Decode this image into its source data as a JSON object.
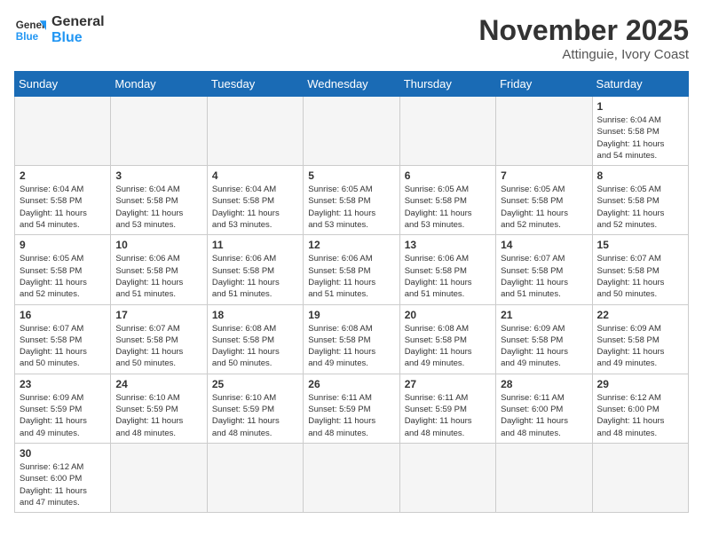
{
  "header": {
    "logo_general": "General",
    "logo_blue": "Blue",
    "month_title": "November 2025",
    "location": "Attinguie, Ivory Coast"
  },
  "weekdays": [
    "Sunday",
    "Monday",
    "Tuesday",
    "Wednesday",
    "Thursday",
    "Friday",
    "Saturday"
  ],
  "days": [
    {
      "date": "",
      "info": ""
    },
    {
      "date": "",
      "info": ""
    },
    {
      "date": "",
      "info": ""
    },
    {
      "date": "",
      "info": ""
    },
    {
      "date": "",
      "info": ""
    },
    {
      "date": "",
      "info": ""
    },
    {
      "date": "1",
      "info": "Sunrise: 6:04 AM\nSunset: 5:58 PM\nDaylight: 11 hours\nand 54 minutes."
    },
    {
      "date": "2",
      "info": "Sunrise: 6:04 AM\nSunset: 5:58 PM\nDaylight: 11 hours\nand 54 minutes."
    },
    {
      "date": "3",
      "info": "Sunrise: 6:04 AM\nSunset: 5:58 PM\nDaylight: 11 hours\nand 53 minutes."
    },
    {
      "date": "4",
      "info": "Sunrise: 6:04 AM\nSunset: 5:58 PM\nDaylight: 11 hours\nand 53 minutes."
    },
    {
      "date": "5",
      "info": "Sunrise: 6:05 AM\nSunset: 5:58 PM\nDaylight: 11 hours\nand 53 minutes."
    },
    {
      "date": "6",
      "info": "Sunrise: 6:05 AM\nSunset: 5:58 PM\nDaylight: 11 hours\nand 53 minutes."
    },
    {
      "date": "7",
      "info": "Sunrise: 6:05 AM\nSunset: 5:58 PM\nDaylight: 11 hours\nand 52 minutes."
    },
    {
      "date": "8",
      "info": "Sunrise: 6:05 AM\nSunset: 5:58 PM\nDaylight: 11 hours\nand 52 minutes."
    },
    {
      "date": "9",
      "info": "Sunrise: 6:05 AM\nSunset: 5:58 PM\nDaylight: 11 hours\nand 52 minutes."
    },
    {
      "date": "10",
      "info": "Sunrise: 6:06 AM\nSunset: 5:58 PM\nDaylight: 11 hours\nand 51 minutes."
    },
    {
      "date": "11",
      "info": "Sunrise: 6:06 AM\nSunset: 5:58 PM\nDaylight: 11 hours\nand 51 minutes."
    },
    {
      "date": "12",
      "info": "Sunrise: 6:06 AM\nSunset: 5:58 PM\nDaylight: 11 hours\nand 51 minutes."
    },
    {
      "date": "13",
      "info": "Sunrise: 6:06 AM\nSunset: 5:58 PM\nDaylight: 11 hours\nand 51 minutes."
    },
    {
      "date": "14",
      "info": "Sunrise: 6:07 AM\nSunset: 5:58 PM\nDaylight: 11 hours\nand 51 minutes."
    },
    {
      "date": "15",
      "info": "Sunrise: 6:07 AM\nSunset: 5:58 PM\nDaylight: 11 hours\nand 50 minutes."
    },
    {
      "date": "16",
      "info": "Sunrise: 6:07 AM\nSunset: 5:58 PM\nDaylight: 11 hours\nand 50 minutes."
    },
    {
      "date": "17",
      "info": "Sunrise: 6:07 AM\nSunset: 5:58 PM\nDaylight: 11 hours\nand 50 minutes."
    },
    {
      "date": "18",
      "info": "Sunrise: 6:08 AM\nSunset: 5:58 PM\nDaylight: 11 hours\nand 50 minutes."
    },
    {
      "date": "19",
      "info": "Sunrise: 6:08 AM\nSunset: 5:58 PM\nDaylight: 11 hours\nand 49 minutes."
    },
    {
      "date": "20",
      "info": "Sunrise: 6:08 AM\nSunset: 5:58 PM\nDaylight: 11 hours\nand 49 minutes."
    },
    {
      "date": "21",
      "info": "Sunrise: 6:09 AM\nSunset: 5:58 PM\nDaylight: 11 hours\nand 49 minutes."
    },
    {
      "date": "22",
      "info": "Sunrise: 6:09 AM\nSunset: 5:58 PM\nDaylight: 11 hours\nand 49 minutes."
    },
    {
      "date": "23",
      "info": "Sunrise: 6:09 AM\nSunset: 5:59 PM\nDaylight: 11 hours\nand 49 minutes."
    },
    {
      "date": "24",
      "info": "Sunrise: 6:10 AM\nSunset: 5:59 PM\nDaylight: 11 hours\nand 48 minutes."
    },
    {
      "date": "25",
      "info": "Sunrise: 6:10 AM\nSunset: 5:59 PM\nDaylight: 11 hours\nand 48 minutes."
    },
    {
      "date": "26",
      "info": "Sunrise: 6:11 AM\nSunset: 5:59 PM\nDaylight: 11 hours\nand 48 minutes."
    },
    {
      "date": "27",
      "info": "Sunrise: 6:11 AM\nSunset: 5:59 PM\nDaylight: 11 hours\nand 48 minutes."
    },
    {
      "date": "28",
      "info": "Sunrise: 6:11 AM\nSunset: 6:00 PM\nDaylight: 11 hours\nand 48 minutes."
    },
    {
      "date": "29",
      "info": "Sunrise: 6:12 AM\nSunset: 6:00 PM\nDaylight: 11 hours\nand 48 minutes."
    },
    {
      "date": "30",
      "info": "Sunrise: 6:12 AM\nSunset: 6:00 PM\nDaylight: 11 hours\nand 47 minutes."
    },
    {
      "date": "",
      "info": ""
    },
    {
      "date": "",
      "info": ""
    },
    {
      "date": "",
      "info": ""
    },
    {
      "date": "",
      "info": ""
    },
    {
      "date": "",
      "info": ""
    },
    {
      "date": "",
      "info": ""
    }
  ]
}
